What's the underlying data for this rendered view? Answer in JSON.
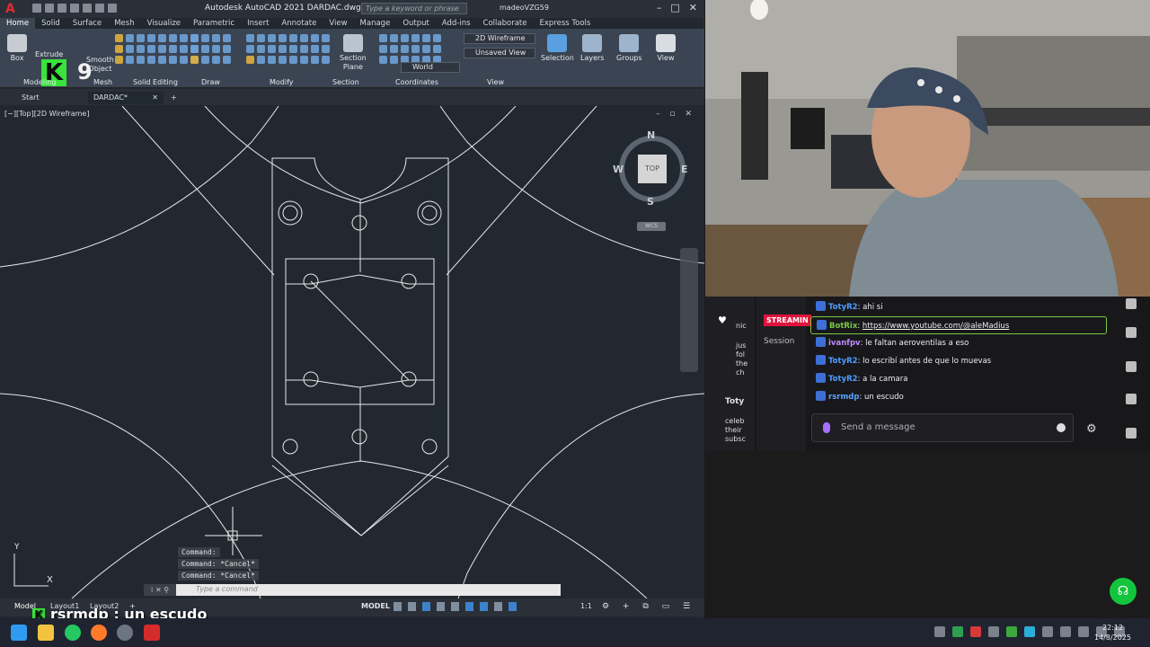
{
  "autocad": {
    "title": "Autodesk AutoCAD 2021   DARDAC.dwg",
    "search_placeholder": "Type a keyword or phrase",
    "user": "madeoVZG59",
    "menu_tabs": [
      "Home",
      "Solid",
      "Surface",
      "Mesh",
      "Visualize",
      "Parametric",
      "Insert",
      "Annotate",
      "View",
      "Manage",
      "Output",
      "Add-ins",
      "Collaborate",
      "Express Tools"
    ],
    "active_tab": "Home",
    "ribbon": {
      "box": "Box",
      "extrude": "Extrude",
      "smooth_object_1": "Smooth",
      "smooth_object_2": "Object",
      "section_plane_1": "Section",
      "section_plane_2": "Plane",
      "visual_style": "2D Wireframe",
      "unsaved_view": "Unsaved View",
      "world": "World",
      "selection": "Selection",
      "layers": "Layers",
      "groups": "Groups",
      "view": "View",
      "panels": [
        "Modeling",
        "Mesh",
        "Solid Editing",
        "Draw",
        "Modify",
        "Section",
        "Coordinates",
        "View"
      ]
    },
    "overlay_count": "9",
    "doc_tabs": {
      "start": "Start",
      "active": "DARDAC*"
    },
    "viewport_label": "[−][Top][2D Wireframe]",
    "viewcube": {
      "n": "N",
      "s": "S",
      "e": "E",
      "w": "W",
      "face": "TOP",
      "wcs": "WCS"
    },
    "ucs": {
      "y": "Y",
      "x": "X"
    },
    "command_history": [
      "Command:",
      "Command: *Cancel*",
      "Command: *Cancel*"
    ],
    "command_placeholder": "Type a command",
    "status": {
      "model_tab": "Model",
      "layout1": "Layout1",
      "layout2": "Layout2",
      "model_space": "MODEL",
      "scale": "1:1"
    }
  },
  "overlay": {
    "user": "rsrmdp",
    "text": " : un escudo"
  },
  "chat": {
    "streaming": "STREAMIN",
    "session": "Session",
    "left_items": [
      "nic",
      "jus",
      "fol",
      "the",
      "ch",
      "Toty",
      "celeb",
      "their",
      "subsc"
    ],
    "messages": [
      {
        "user": "TotyR2",
        "text": ": ahi si",
        "color": "#4d9cff",
        "link": ""
      },
      {
        "user": "BotRix",
        "text": ": ",
        "color": "#7ac943",
        "link": "https://www.youtube.com/@aleMadius"
      },
      {
        "user": "ivanfpv",
        "text": ": le faltan aeroventilas a eso",
        "color": "#c08cff",
        "link": ""
      },
      {
        "user": "TotyR2",
        "text": ": lo escribí antes de que lo muevas",
        "color": "#4d9cff",
        "link": ""
      },
      {
        "user": "TotyR2",
        "text": ": a la camara",
        "color": "#4d9cff",
        "link": ""
      },
      {
        "user": "rsrmdp",
        "text": ": un escudo",
        "color": "#5aa3ff",
        "link": ""
      }
    ],
    "input_placeholder": "Send a message"
  },
  "taskbar": {
    "time": "22:12",
    "date": "14/8/2025"
  },
  "colors": {
    "accent": "#38e33b",
    "autocad_red": "#e02b2b",
    "twitch_purple": "#a970ff",
    "streaming_red": "#e0133c"
  }
}
